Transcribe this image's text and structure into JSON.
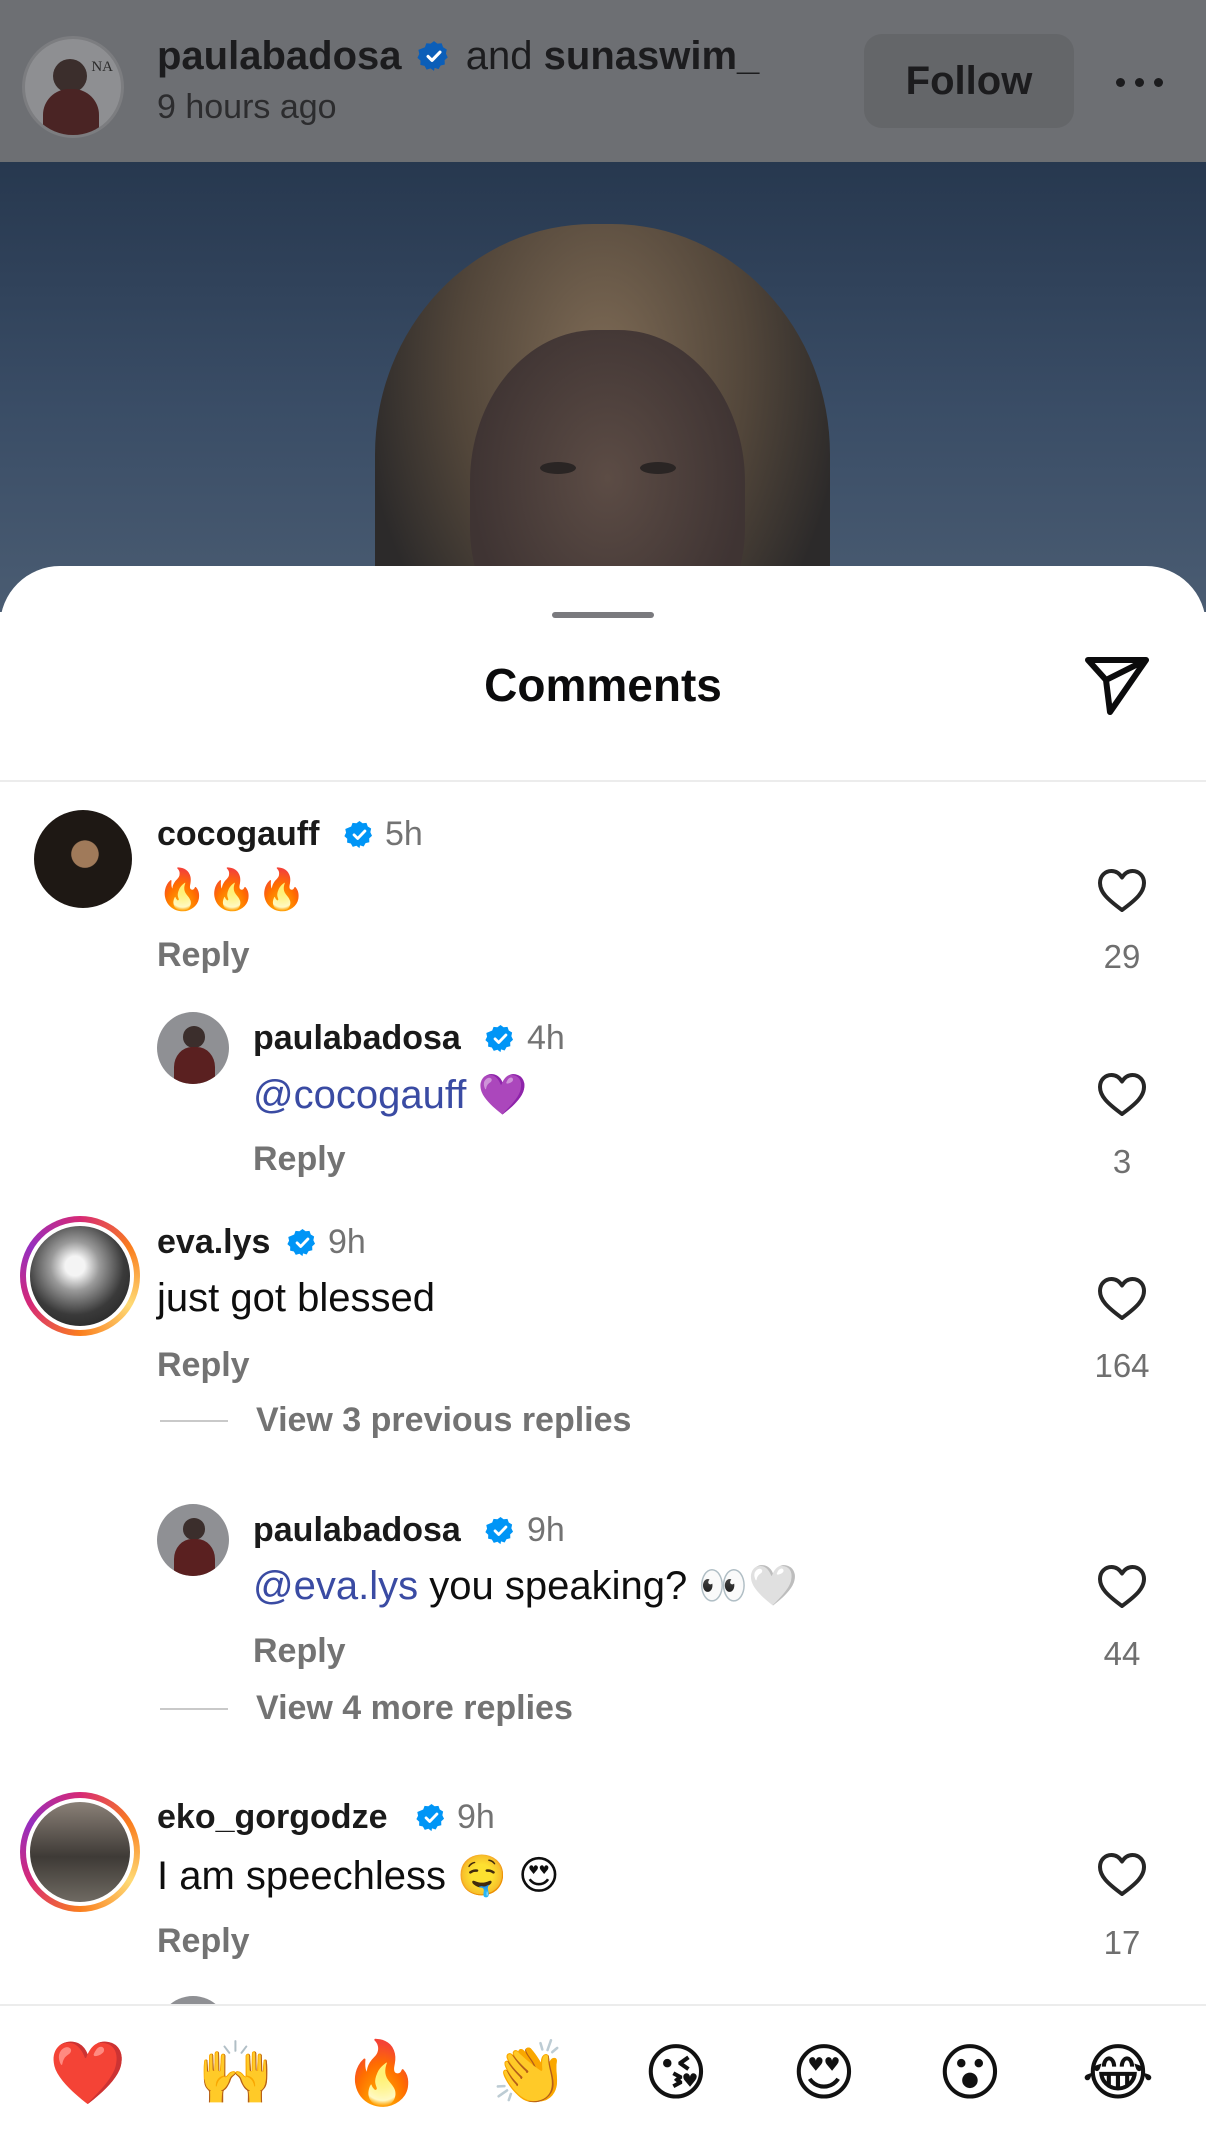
{
  "post_header": {
    "user1": "paulabadosa",
    "joiner": "and",
    "user2": "sunaswim_",
    "time": "9 hours ago",
    "follow_label": "Follow",
    "avatar_text": "NA"
  },
  "sheet": {
    "title": "Comments"
  },
  "comments": [
    {
      "username": "cocogauff",
      "time": "5h",
      "text": "🔥🔥🔥",
      "reply": "Reply",
      "likes": "29"
    },
    {
      "username": "paulabadosa",
      "time": "4h",
      "mention": "@cocogauff",
      "text": " 💜",
      "reply": "Reply",
      "likes": "3"
    },
    {
      "username": "eva.lys",
      "time": "9h",
      "text": "just got blessed",
      "reply": "Reply",
      "likes": "164",
      "view_replies": "View 3 previous replies"
    },
    {
      "username": "paulabadosa",
      "time": "9h",
      "mention": "@eva.lys",
      "text": " you speaking? 👀🤍",
      "reply": "Reply",
      "likes": "44",
      "view_replies": "View 4 more replies"
    },
    {
      "username": "eko_gorgodze",
      "time": "9h",
      "text": "I am speechless 🤤 😍",
      "reply": "Reply",
      "likes": "17"
    }
  ],
  "reactions": [
    "❤️",
    "🙌",
    "🔥",
    "👏",
    "😘",
    "😍",
    "😮",
    "😂"
  ],
  "colors": {
    "verified": "#0095f6",
    "mention": "#3a4ba3",
    "muted": "#737373"
  },
  "icons": {
    "share": "send-icon",
    "like": "heart-outline-icon",
    "verified": "verified-badge-icon",
    "more": "more-horizontal-icon"
  }
}
